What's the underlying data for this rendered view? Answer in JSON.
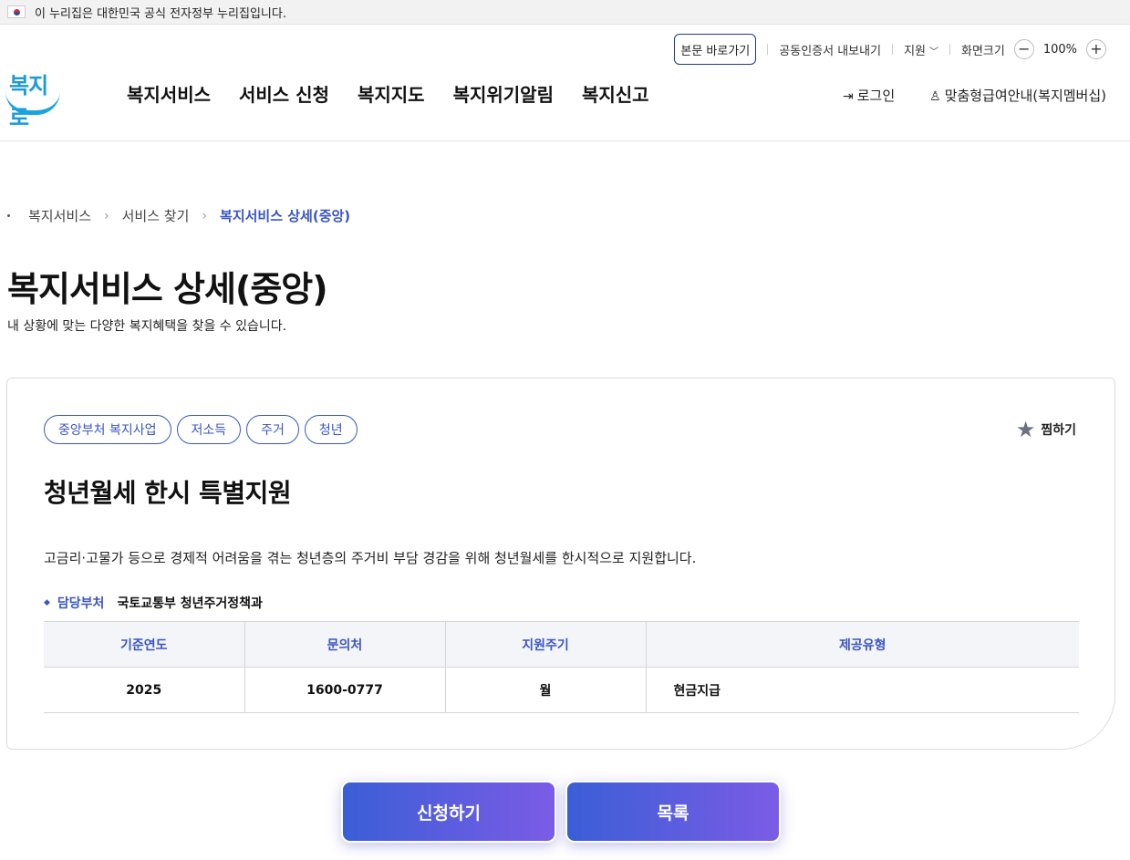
{
  "gov_banner": {
    "text": "이 누리집은 대한민국 공식 전자정부 누리집입니다."
  },
  "utility": {
    "skip_link": "본문 바로가기",
    "cert_export": "공동인증서 내보내기",
    "support": "지원",
    "screen_size": "화면크기",
    "zoom_out": "−",
    "zoom_value": "100%",
    "zoom_in": "+"
  },
  "logo": {
    "text": "복지로"
  },
  "gnb": {
    "items": [
      "복지서비스",
      "서비스 신청",
      "복지지도",
      "복지위기알림",
      "복지신고"
    ]
  },
  "user": {
    "login": "로그인",
    "membership": "맞춤형급여안내(복지멤버십)"
  },
  "breadcrumb": {
    "items": [
      "복지서비스",
      "서비스 찾기",
      "복지서비스 상세(중앙)"
    ]
  },
  "page": {
    "title": "복지서비스 상세(중앙)",
    "description": "내 상황에 맞는 다양한 복지혜택을 찾을 수 있습니다."
  },
  "service": {
    "tags": [
      "중앙부처 복지사업",
      "저소득",
      "주거",
      "청년"
    ],
    "bookmark": "찜하기",
    "title": "청년월세 한시 특별지원",
    "description": "고금리·고물가 등으로 경제적 어려움을 겪는 청년층의 주거비 부담 경감을 위해 청년월세를 한시적으로 지원합니다.",
    "dept_label": "담당부처",
    "dept_value": "국토교통부 청년주거정책과",
    "table": {
      "headers": [
        "기준연도",
        "문의처",
        "지원주기",
        "제공유형"
      ],
      "row": [
        "2025",
        "1600-0777",
        "월",
        "현금지급"
      ]
    }
  },
  "actions": {
    "apply": "신청하기",
    "list": "목록"
  },
  "colors": {
    "accent": "#3a55c4",
    "button_start": "#3a5ed6",
    "button_end": "#7b5ce6"
  }
}
